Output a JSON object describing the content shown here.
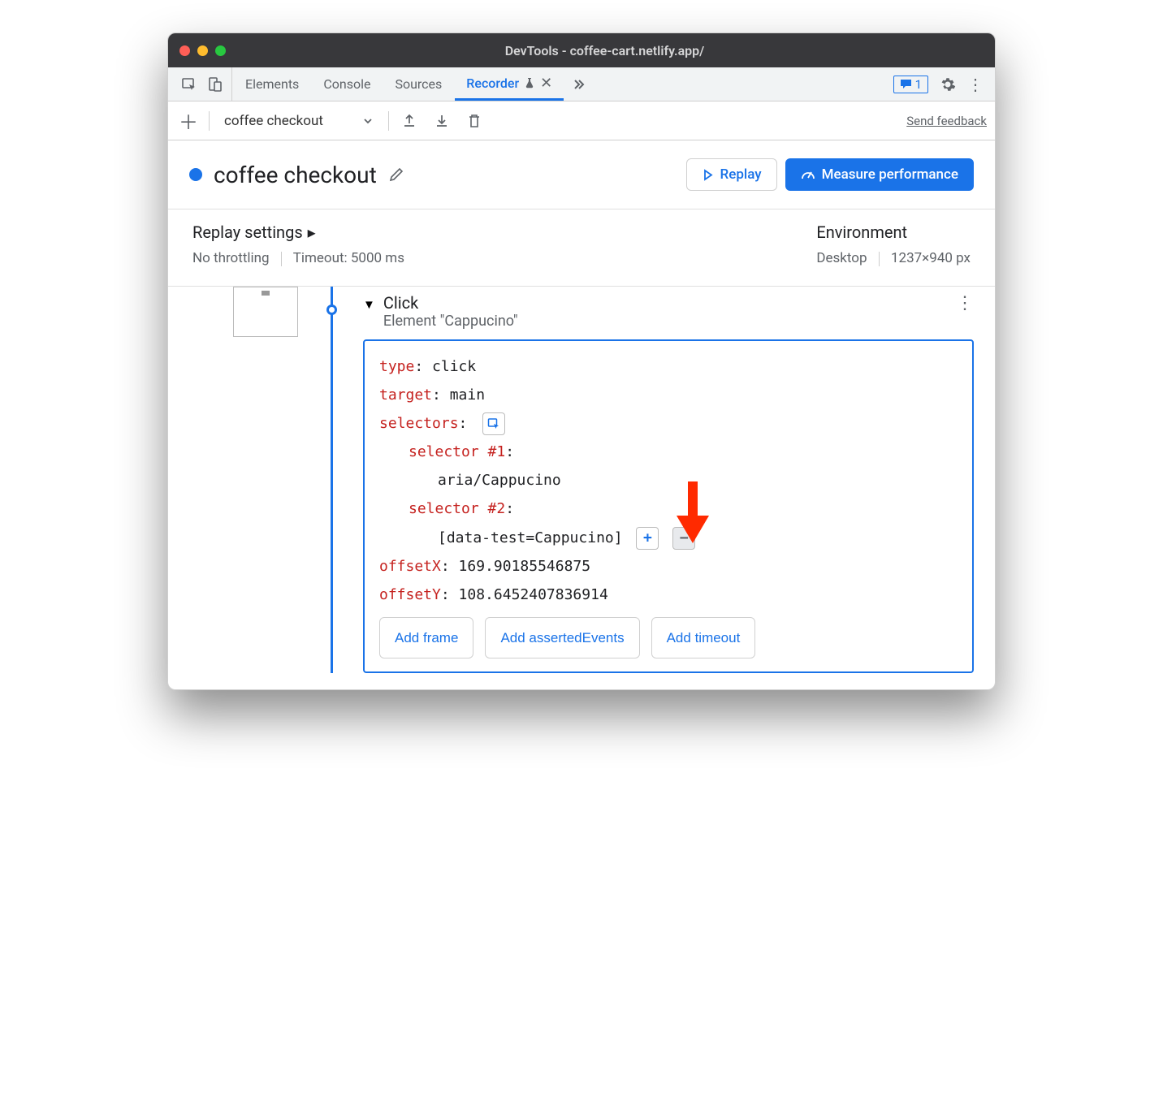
{
  "window": {
    "title": "DevTools - coffee-cart.netlify.app/"
  },
  "tabs": {
    "elements": "Elements",
    "console": "Console",
    "sources": "Sources",
    "recorder": "Recorder",
    "issues_count": "1"
  },
  "toolbar": {
    "recording_name": "coffee checkout",
    "feedback": "Send feedback"
  },
  "header": {
    "title": "coffee checkout",
    "replay": "Replay",
    "measure": "Measure performance"
  },
  "info": {
    "replay_settings": "Replay settings",
    "throttling": "No throttling",
    "timeout": "Timeout: 5000 ms",
    "environment": "Environment",
    "device": "Desktop",
    "dims": "1237×940 px"
  },
  "step": {
    "action": "Click",
    "element_label": "Element \"Cappucino\"",
    "type_key": "type",
    "type_val": "click",
    "target_key": "target",
    "target_val": "main",
    "selectors_key": "selectors",
    "sel1_key": "selector #1",
    "sel1_val": "aria/Cappucino",
    "sel2_key": "selector #2",
    "sel2_val": "[data-test=Cappucino]",
    "offx_key": "offsetX",
    "offx_val": "169.90185546875",
    "offy_key": "offsetY",
    "offy_val": "108.6452407836914",
    "add_frame": "Add frame",
    "add_asserted": "Add assertedEvents",
    "add_timeout": "Add timeout"
  }
}
